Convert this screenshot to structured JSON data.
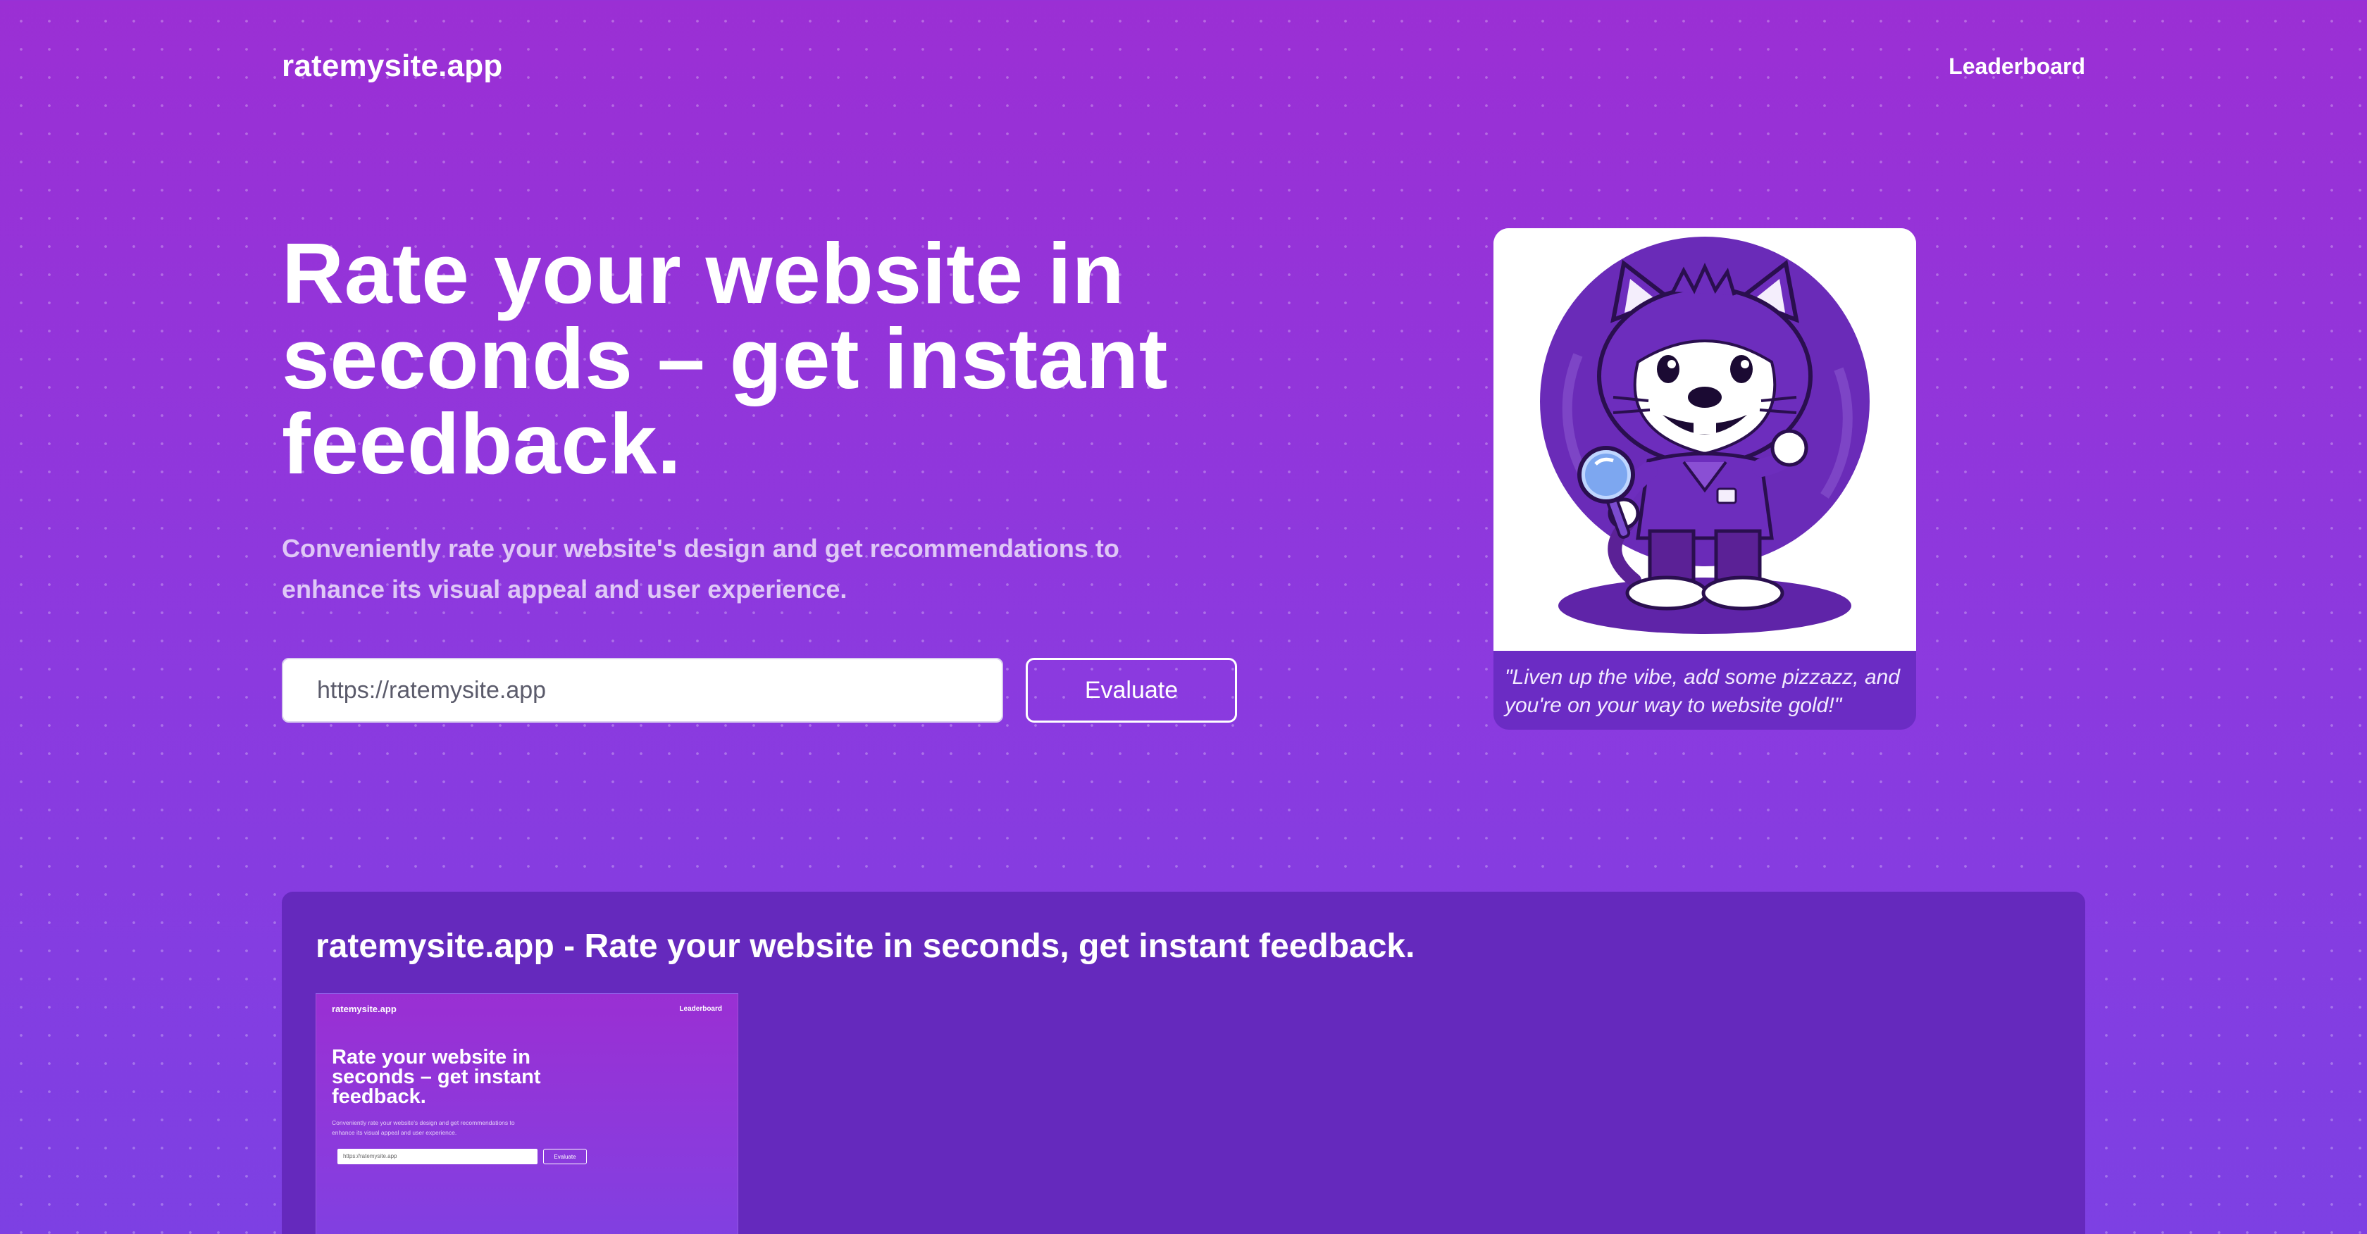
{
  "nav": {
    "brand": "ratemysite.app",
    "leaderboard_label": "Leaderboard"
  },
  "hero": {
    "title": "Rate your website in seconds – get instant feedback.",
    "subtitle": "Conveniently rate your website's design and get recommendations to enhance its visual appeal and user experience.",
    "url_placeholder": "https://ratemysite.app",
    "evaluate_label": "Evaluate"
  },
  "mascot": {
    "icon": "cat-mascot-with-magnifying-glass",
    "quote": "\"Liven up the vibe, add some pizzazz, and you're on your way to website gold!\""
  },
  "panel": {
    "title": "ratemysite.app - Rate your website in seconds, get instant feedback.",
    "thumb": {
      "brand": "ratemysite.app",
      "link": "Leaderboard",
      "title": "Rate your website in seconds – get instant feedback.",
      "subtitle": "Conveniently rate your website's design and get recommendations to enhance its visual appeal and user experience.",
      "input": "https://ratemysite.app",
      "button": "Evaluate"
    }
  },
  "colors": {
    "bg_top": "#9b2fd4",
    "bg_bottom": "#7d40e3",
    "panel": "#6529bd",
    "mascot_purple": "#6a2bb8"
  }
}
